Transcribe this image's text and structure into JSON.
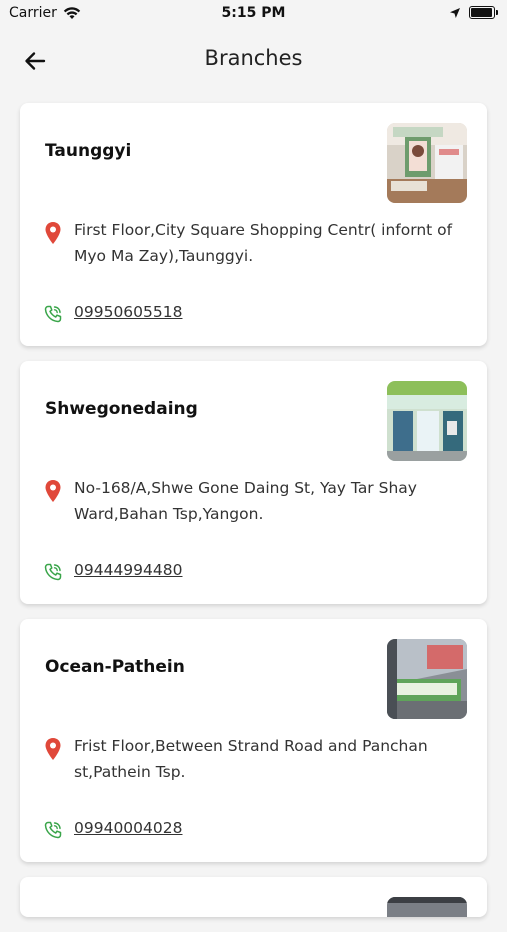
{
  "status": {
    "carrier": "Carrier",
    "time": "5:15 PM"
  },
  "header": {
    "title": "Branches"
  },
  "colors": {
    "pin": "#e0483a",
    "phone": "#3aa54a",
    "background": "#f4f4f4"
  },
  "branches": [
    {
      "name": "Taunggyi",
      "address": "First Floor,City Square Shopping Centr( infornt of Myo Ma Zay),Taunggyi.",
      "phone": "09950605518",
      "icons": {
        "location": "location-pin-icon",
        "phone": "phone-icon"
      }
    },
    {
      "name": "Shwegonedaing",
      "address": "No-168/A,Shwe Gone Daing St, Yay Tar Shay Ward,Bahan Tsp,Yangon.",
      "phone": "09444994480",
      "icons": {
        "location": "location-pin-icon",
        "phone": "phone-icon"
      }
    },
    {
      "name": "Ocean-Pathein",
      "address": "Frist Floor,Between Strand Road and Panchan st,Pathein Tsp.",
      "phone": "09940004028",
      "icons": {
        "location": "location-pin-icon",
        "phone": "phone-icon"
      }
    }
  ]
}
